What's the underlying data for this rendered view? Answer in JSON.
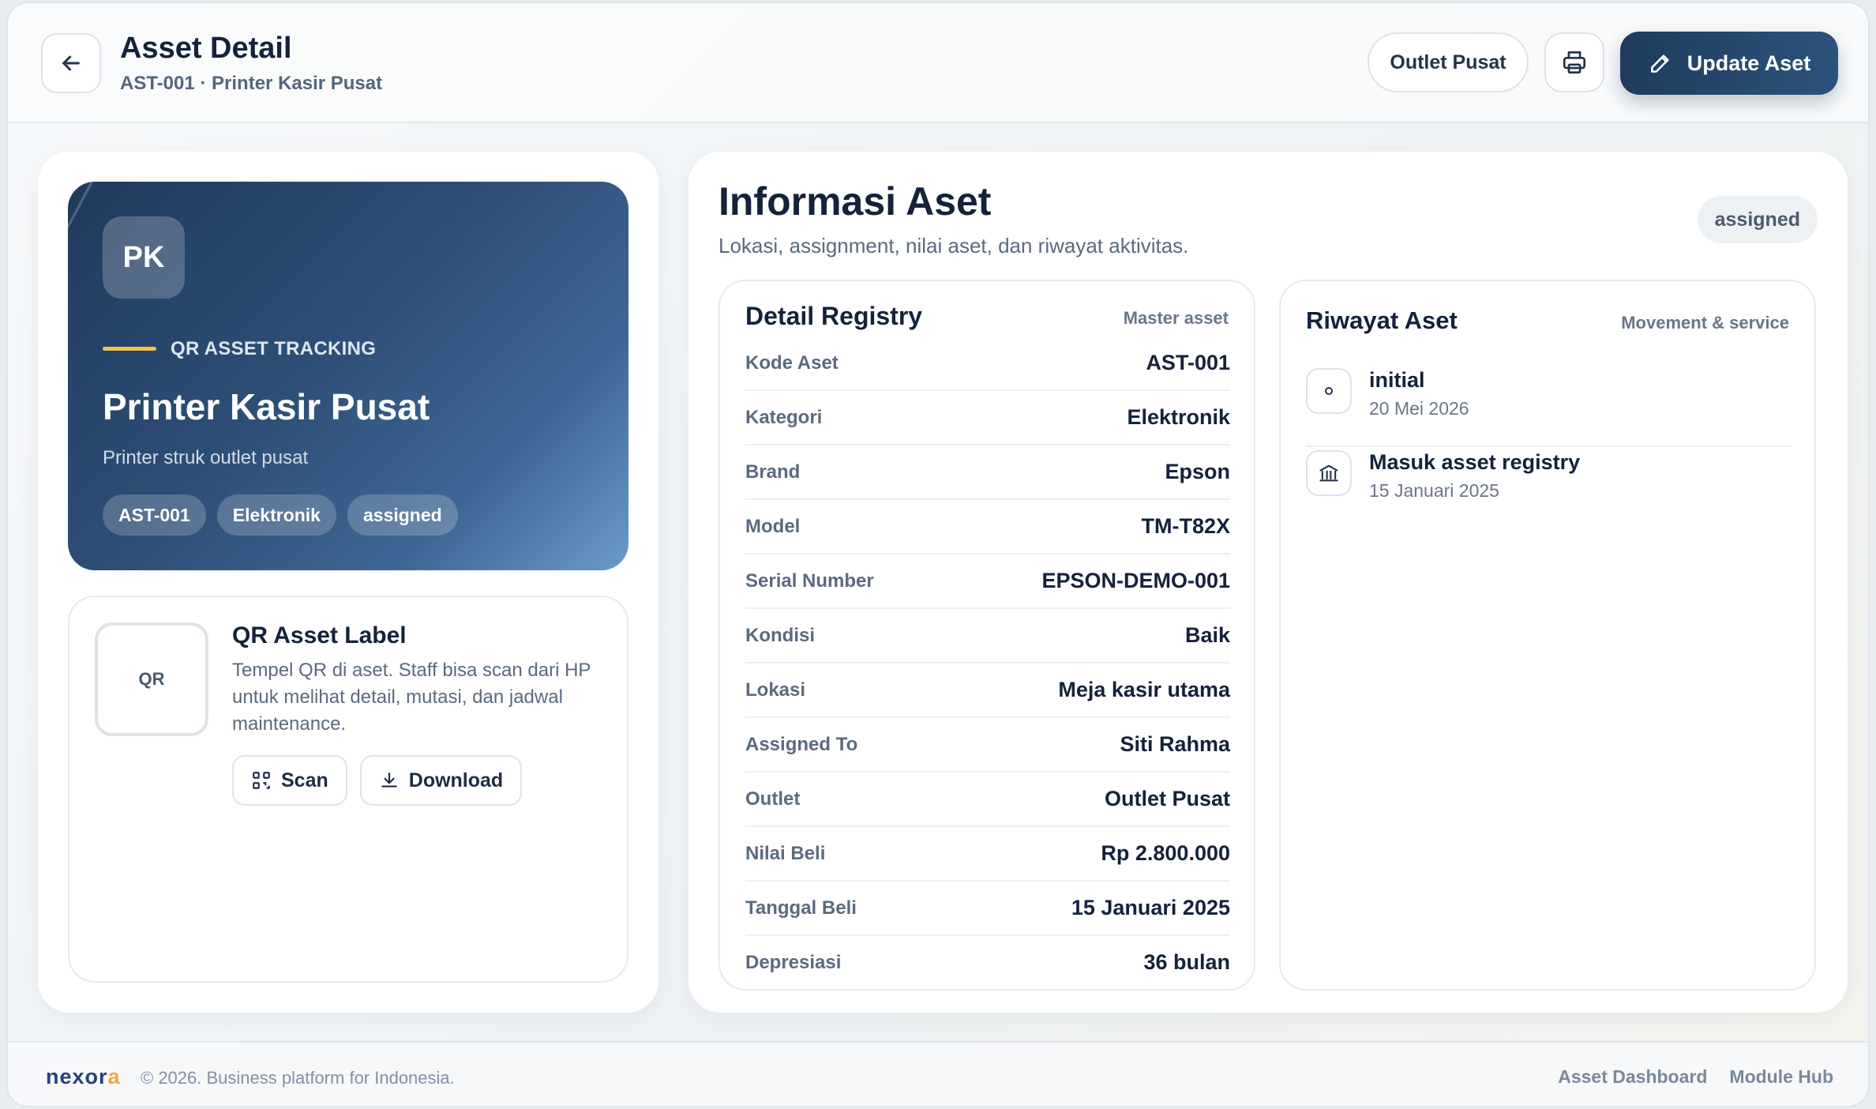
{
  "header": {
    "title": "Asset Detail",
    "subtitle": "AST-001 · Printer Kasir Pusat",
    "outlet_label": "Outlet Pusat",
    "update_label": "Update Aset"
  },
  "hero": {
    "initials": "PK",
    "kicker": "QR ASSET TRACKING",
    "title": "Printer Kasir Pusat",
    "description": "Printer struk outlet pusat",
    "chips": [
      "AST-001",
      "Elektronik",
      "assigned"
    ],
    "kicker_color": "#f2c14e"
  },
  "qr_label": {
    "box_text": "QR",
    "title": "QR Asset Label",
    "description": "Tempel QR di aset. Staff bisa scan dari HP untuk melihat detail, mutasi, dan jadwal maintenance.",
    "scan_label": "Scan",
    "download_label": "Download"
  },
  "info": {
    "title": "Informasi Aset",
    "subtitle": "Lokasi, assignment, nilai aset, dan riwayat aktivitas.",
    "status": "assigned"
  },
  "registry": {
    "title": "Detail Registry",
    "tag": "Master asset",
    "rows": [
      {
        "label": "Kode Aset",
        "value": "AST-001"
      },
      {
        "label": "Kategori",
        "value": "Elektronik"
      },
      {
        "label": "Brand",
        "value": "Epson"
      },
      {
        "label": "Model",
        "value": "TM-T82X"
      },
      {
        "label": "Serial Number",
        "value": "EPSON-DEMO-001"
      },
      {
        "label": "Kondisi",
        "value": "Baik"
      },
      {
        "label": "Lokasi",
        "value": "Meja kasir utama"
      },
      {
        "label": "Assigned To",
        "value": "Siti Rahma"
      },
      {
        "label": "Outlet",
        "value": "Outlet Pusat"
      },
      {
        "label": "Nilai Beli",
        "value": "Rp 2.800.000"
      },
      {
        "label": "Tanggal Beli",
        "value": "15 Januari 2025"
      },
      {
        "label": "Depresiasi",
        "value": "36 bulan"
      }
    ]
  },
  "history": {
    "title": "Riwayat Aset",
    "tag": "Movement & service",
    "items": [
      {
        "name": "initial",
        "date": "20 Mei 2026",
        "icon": "circle-icon"
      },
      {
        "name": "Masuk asset registry",
        "date": "15 Januari 2025",
        "icon": "building-icon"
      }
    ]
  },
  "footer": {
    "logo_main": "nexor",
    "logo_accent": "a",
    "copyright": "© 2026. Business platform for Indonesia.",
    "links": [
      "Asset Dashboard",
      "Module Hub"
    ]
  },
  "colors": {
    "primary": "#1f3c5c",
    "accent": "#f2c14e",
    "text": "#14223a"
  }
}
